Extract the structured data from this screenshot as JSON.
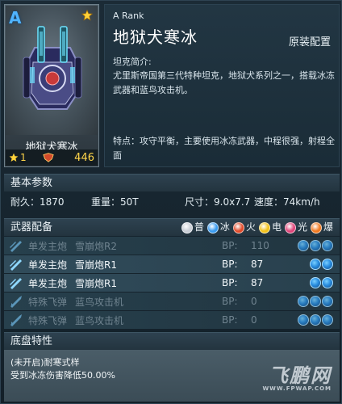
{
  "card": {
    "rank_letter": "A",
    "name": "地狱犬寒冰",
    "level": "1",
    "power": "446"
  },
  "info": {
    "rank": "A  Rank",
    "title": "地狱犬寒冰",
    "config": "原装配置",
    "intro_label": "坦克简介:",
    "intro": "尤里斯帝国第三代特种坦克，地狱犬系列之一，搭载冰冻武器和蓝鸟攻击机。",
    "feature": "特点：攻守平衡，主要使用冰冻武器，中程很强，射程全面"
  },
  "basic": {
    "header": "基本参数",
    "durability": "耐久：1870",
    "weight": "重量：50T",
    "size": "尺寸：9.0x7.7",
    "speed": "速度：74km/h"
  },
  "weapons": {
    "header": "武器配备",
    "legend": [
      {
        "label": "普",
        "color": "#c9ced6"
      },
      {
        "label": "冰",
        "color": "#3b9cf0"
      },
      {
        "label": "火",
        "color": "#e24b2a"
      },
      {
        "label": "电",
        "color": "#f2c21a"
      },
      {
        "label": "光",
        "color": "#e0457a"
      },
      {
        "label": "爆",
        "color": "#f07a22"
      }
    ],
    "rows": [
      {
        "type": "单发主炮",
        "name": "雪崩炮R2",
        "bp_label": "BP:",
        "bp": "110",
        "active": false,
        "kind": "cannon"
      },
      {
        "type": "单发主炮",
        "name": "雪崩炮R1",
        "bp_label": "BP:",
        "bp": "87",
        "active": true,
        "kind": "cannon"
      },
      {
        "type": "单发主炮",
        "name": "雪崩炮R1",
        "bp_label": "BP:",
        "bp": "87",
        "active": true,
        "kind": "cannon"
      },
      {
        "type": "特殊飞弹",
        "name": "蓝鸟攻击机",
        "bp_label": "BP:",
        "bp": "0",
        "active": false,
        "kind": "missile"
      },
      {
        "type": "特殊飞弹",
        "name": "蓝鸟攻击机",
        "bp_label": "BP:",
        "bp": "0",
        "active": false,
        "kind": "missile"
      }
    ]
  },
  "chassis": {
    "header": "底盘特性",
    "line1": "(未开启)耐寒式样",
    "line2": "受到冰冻伤害降低50.00%"
  },
  "watermark": {
    "big": "飞鹏网",
    "small": "WWW.FPWAP.COM"
  }
}
